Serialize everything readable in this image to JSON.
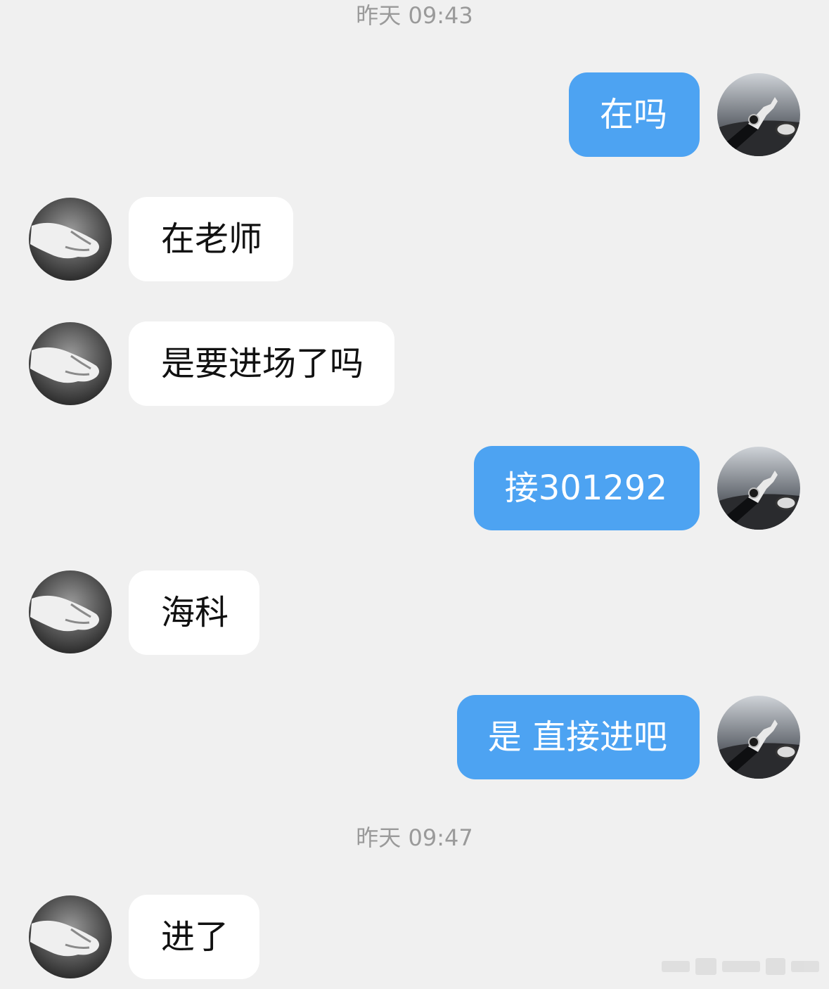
{
  "conversation": {
    "timestamps": [
      "昨天 09:43",
      "昨天 09:47"
    ],
    "messages": [
      {
        "sender": "self",
        "text": "在吗",
        "avatar": "wrist-watch-car-avatar"
      },
      {
        "sender": "other",
        "text": "在老师",
        "avatar": "hand-avatar"
      },
      {
        "sender": "other",
        "text": "是要进场了吗",
        "avatar": "hand-avatar"
      },
      {
        "sender": "self",
        "text": "接301292",
        "avatar": "wrist-watch-car-avatar"
      },
      {
        "sender": "other",
        "text": "海科",
        "avatar": "hand-avatar"
      },
      {
        "sender": "self",
        "text": "是 直接进吧",
        "avatar": "wrist-watch-car-avatar"
      },
      {
        "sender": "other",
        "text": "进了",
        "avatar": "hand-avatar"
      }
    ]
  },
  "colors": {
    "background": "#f0f0f0",
    "outgoing_bubble": "#4da3f2",
    "incoming_bubble": "#ffffff",
    "timestamp_text": "#9a9a9a"
  }
}
